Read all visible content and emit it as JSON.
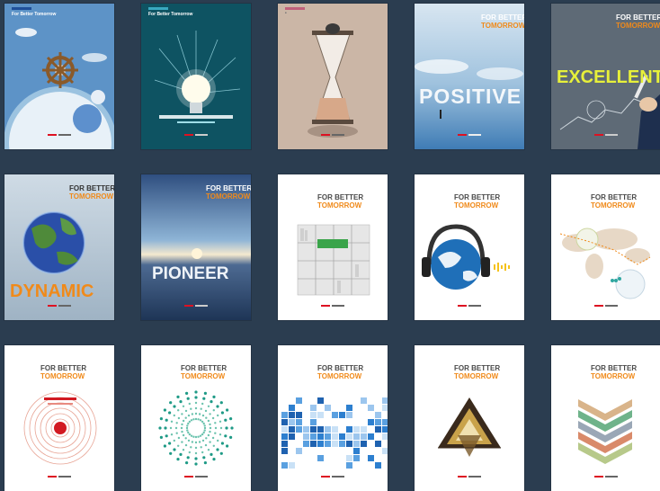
{
  "colors": {
    "background": "#2b3d50",
    "accent_orange": "#f08a1a",
    "brand_red": "#d21a22",
    "title_gray": "#4a4a4a"
  },
  "covers": [
    {
      "title": "For Better Tomorrow",
      "icon": "ship-wheel-globe"
    },
    {
      "title": "For Better Tomorrow",
      "icon": "light-bulb"
    },
    {
      "title": "",
      "icon": "hourglass"
    },
    {
      "line1": "FOR BETTER",
      "line2": "TOMORROW",
      "word": "POSITIVE",
      "icon": "sea-horizon"
    },
    {
      "line1": "FOR BETTER",
      "line2": "TOMORROW",
      "word": "EXCELLENT",
      "icon": "pen-hand"
    },
    {
      "line1": "FOR BETTER",
      "line2": "TOMORROW",
      "word": "DYNAMIC",
      "icon": "earth-globe"
    },
    {
      "line1": "FOR BETTER",
      "line2": "TOMORROW",
      "word": "PIONEER",
      "icon": "sunset-sea"
    },
    {
      "line1": "FOR BETTER",
      "line2": "TOMORROW",
      "icon": "bookshelf"
    },
    {
      "line1": "FOR BETTER",
      "line2": "TOMORROW",
      "icon": "headphones-globe"
    },
    {
      "line1": "FOR BETTER",
      "line2": "TOMORROW",
      "icon": "world-map-route"
    },
    {
      "line1": "FOR BETTER",
      "line2": "TOMORROW",
      "icon": "sound-waves"
    },
    {
      "line1": "FOR BETTER",
      "line2": "TOMORROW",
      "icon": "dot-burst"
    },
    {
      "line1": "FOR BETTER",
      "line2": "TOMORROW",
      "icon": "blue-pixels"
    },
    {
      "line1": "FOR BETTER",
      "line2": "TOMORROW",
      "icon": "triangles"
    },
    {
      "line1": "FOR BETTER",
      "line2": "TOMORROW",
      "icon": "chevrons"
    }
  ]
}
